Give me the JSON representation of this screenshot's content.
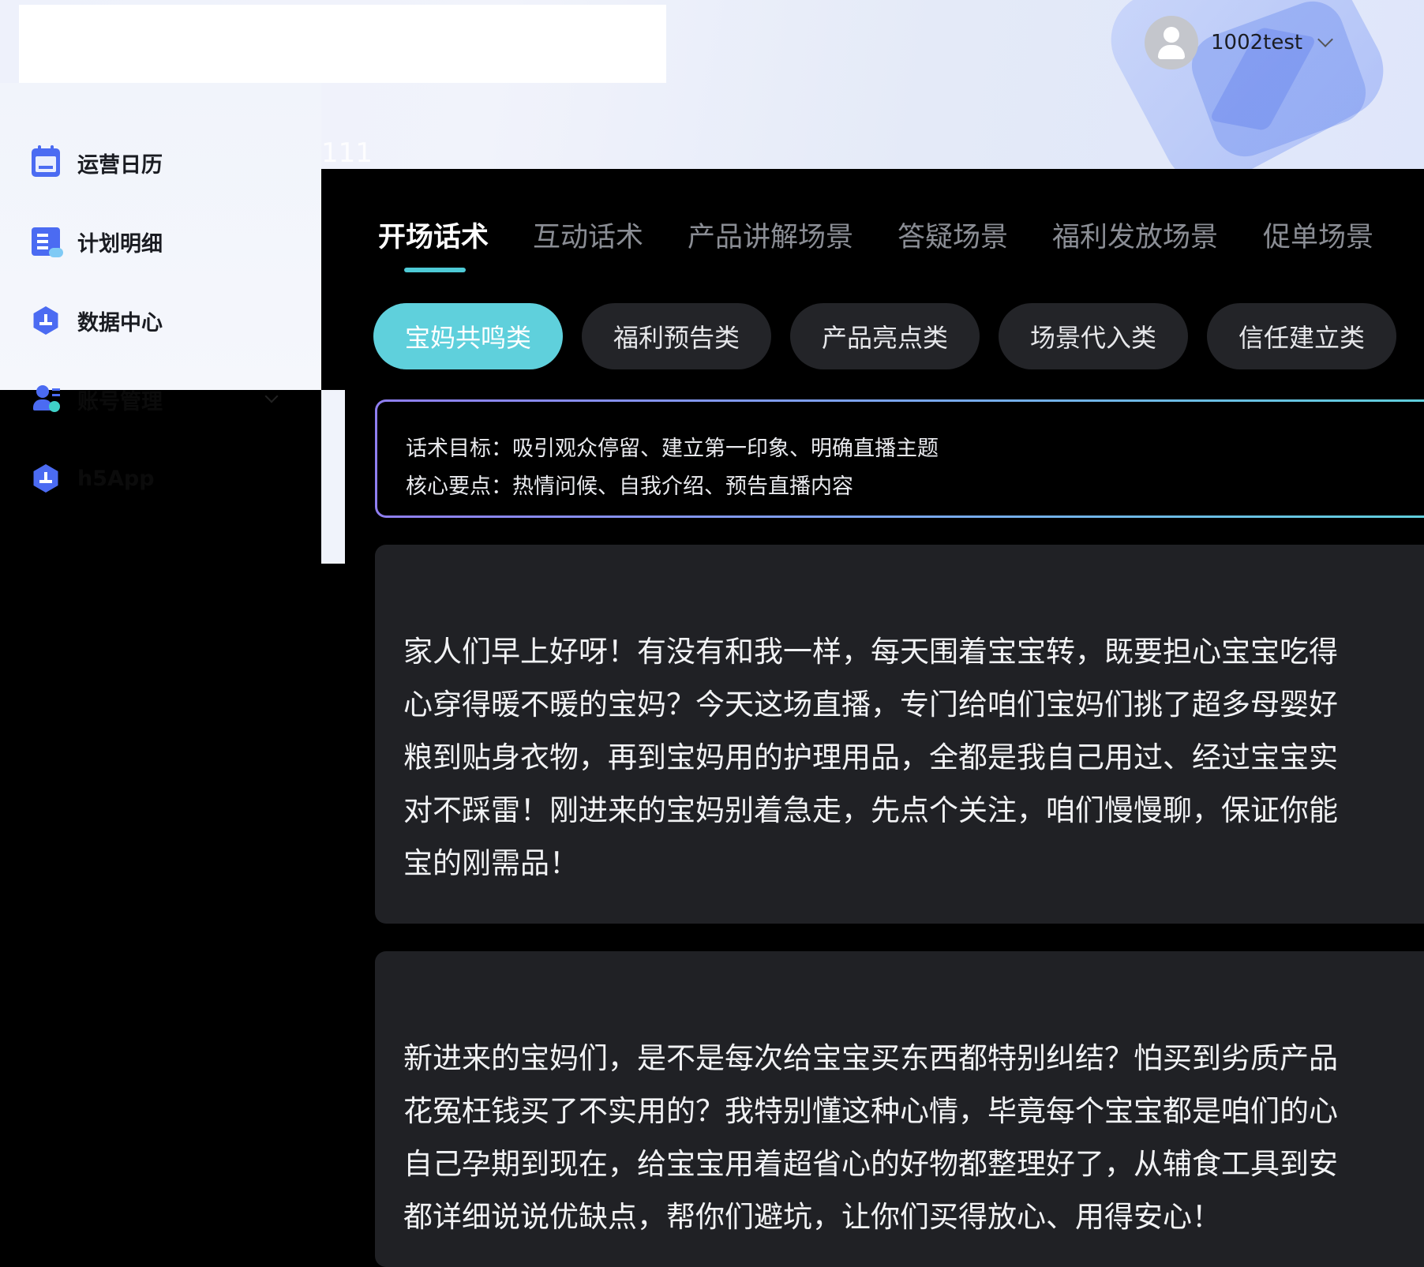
{
  "header": {
    "username": "1002test",
    "overlay_text": "111"
  },
  "sidebar": {
    "items": [
      {
        "label": "运营日历"
      },
      {
        "label": "计划明细"
      },
      {
        "label": "数据中心"
      },
      {
        "label": "账号管理"
      },
      {
        "label": "h5App"
      }
    ]
  },
  "tabs": [
    {
      "label": "开场话术",
      "active": true
    },
    {
      "label": "互动话术"
    },
    {
      "label": "产品讲解场景"
    },
    {
      "label": "答疑场景"
    },
    {
      "label": "福利发放场景"
    },
    {
      "label": "促单场景"
    }
  ],
  "chips": [
    {
      "label": "宝妈共鸣类",
      "active": true
    },
    {
      "label": "福利预告类"
    },
    {
      "label": "产品亮点类"
    },
    {
      "label": "场景代入类"
    },
    {
      "label": "信任建立类"
    }
  ],
  "goal": {
    "line1": "话术目标：吸引观众停留、建立第一印象、明确直播主题",
    "line2": "核心要点：热情问候、自我介绍、预告直播内容"
  },
  "scripts": [
    {
      "lines": [
        "家人们早上好呀！有没有和我一样，每天围着宝宝转，既要担心宝宝吃得",
        "心穿得暖不暖的宝妈？今天这场直播，专门给咱们宝妈们挑了超多母婴好",
        "粮到贴身衣物，再到宝妈用的护理用品，全都是我自己用过、经过宝宝实",
        "对不踩雷！刚进来的宝妈别着急走，先点个关注，咱们慢慢聊，保证你能",
        "宝的刚需品！"
      ]
    },
    {
      "lines": [
        "新进来的宝妈们，是不是每次给宝宝买东西都特别纠结？怕买到劣质产品",
        "花冤枉钱买了不实用的？我特别懂这种心情，毕竟每个宝宝都是咱们的心",
        "自己孕期到现在，给宝宝用着超省心的好物都整理好了，从辅食工具到安",
        "都详细说说优缺点，帮你们避坑，让你们买得放心、用得安心！"
      ]
    }
  ],
  "colors": {
    "accent": "#5fd0dc",
    "brand_blue": "#4b6bf2",
    "card_bg": "#202125"
  }
}
